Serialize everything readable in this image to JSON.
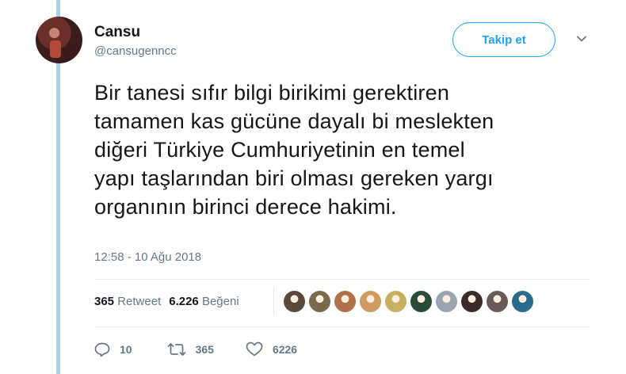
{
  "user": {
    "name": "Cansu",
    "handle": "@cansugenncc"
  },
  "follow_button": {
    "label": "Takip et"
  },
  "tweet": {
    "lines": [
      "Bir tanesi sıfır bilgi birikimi gerektiren",
      "tamamen kas gücüne dayalı bi meslekten",
      "diğeri Türkiye Cumhuriyetinin en temel",
      "yapı taşlarından biri olması gereken yargı",
      "organının birinci derece hakimi."
    ],
    "timestamp": "12:58 - 10 Ağu 2018"
  },
  "stats": {
    "retweets_count": "365",
    "retweets_label": "Retweet",
    "likes_count": "6.226",
    "likes_label": "Beğeni"
  },
  "likers": [
    {
      "color": "#5a4a3a"
    },
    {
      "color": "#7a6a4a"
    },
    {
      "color": "#b0704a"
    },
    {
      "color": "#d09a60"
    },
    {
      "color": "#c8b060"
    },
    {
      "color": "#2a4a3a"
    },
    {
      "color": "#9aa5b0"
    },
    {
      "color": "#3a2a2a"
    },
    {
      "color": "#6a5a5a"
    },
    {
      "color": "#2a6a8a"
    }
  ],
  "actions": {
    "reply_count": "10",
    "retweet_count": "365",
    "like_count": "6226"
  },
  "colors": {
    "accent": "#1da1f2",
    "thread_line": "#a5d4ea",
    "secondary_text": "#657786"
  }
}
